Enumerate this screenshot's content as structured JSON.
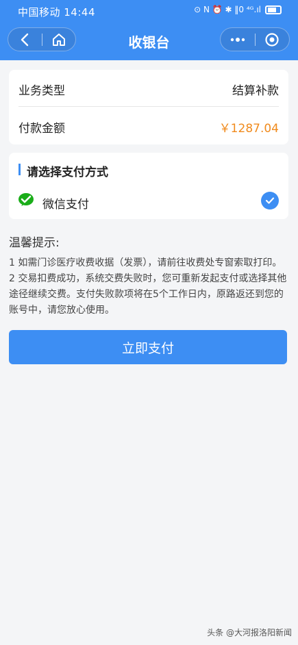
{
  "status_bar": {
    "carrier_time": "中国移动 14:44",
    "right_text": "⊙ N ⏰ ✱ ‖0 ⁴ᴳ.ıl"
  },
  "nav": {
    "title": "收银台"
  },
  "order": {
    "type_label": "业务类型",
    "type_value": "结算补款",
    "amount_label": "付款金额",
    "amount_value": "￥1287.04"
  },
  "payment": {
    "section_title": "请选择支付方式",
    "method_label": "微信支付"
  },
  "tips": {
    "title": "温馨提示:",
    "line1": "1 如需门诊医疗收费收据（发票），请前往收费处专窗索取打印。",
    "line2": "2 交易扣费成功，系统交费失败时，您可重新发起支付或选择其他途径继续交费。支付失败款项将在5个工作日内，原路返还到您的账号中，请您放心使用。"
  },
  "actions": {
    "pay_label": "立即支付"
  },
  "watermark": "头条 @大河报洛阳新闻",
  "colors": {
    "accent": "#3d8ef3",
    "amount": "#f08a1c",
    "wechat": "#1aad19"
  }
}
